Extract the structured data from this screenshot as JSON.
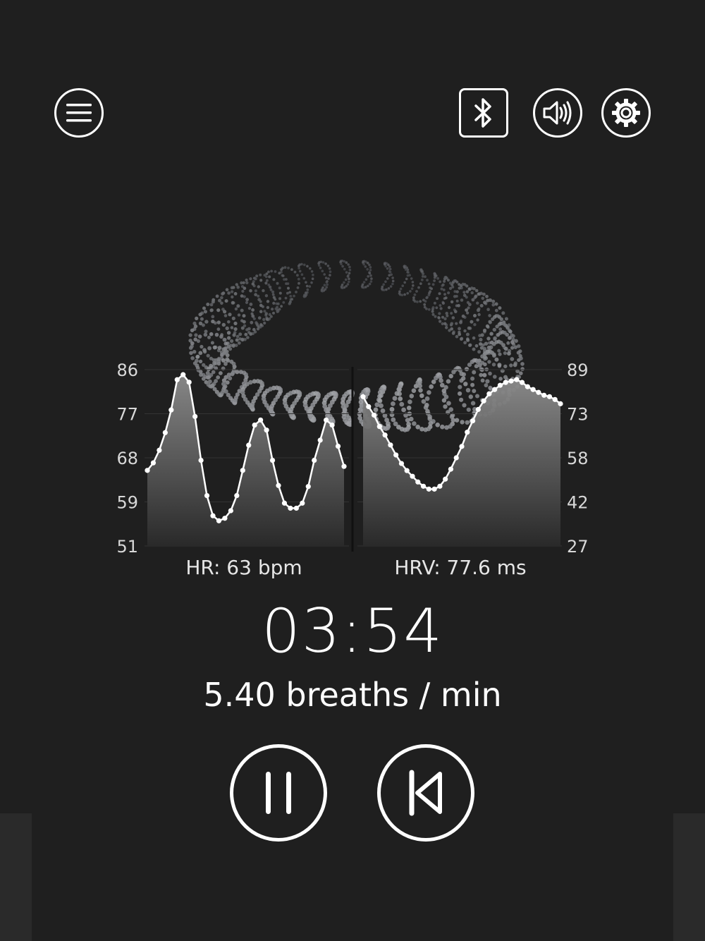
{
  "icons": {
    "menu": "hamburger-menu-icon",
    "bluetooth": "bluetooth-icon",
    "sound": "speaker-volume-icon",
    "settings": "gear-icon",
    "pause": "pause-icon",
    "restart": "skip-back-icon"
  },
  "colors": {
    "background": "#1f1f1f",
    "foreground": "#ffffff",
    "visualization": "#8a8d93"
  },
  "chart_data": [
    {
      "type": "line",
      "title": "",
      "caption": "HR: 63 bpm",
      "y_ticks": [
        "86",
        "77",
        "68",
        "59",
        "51"
      ],
      "ylim": [
        51,
        86
      ],
      "fill": "area-gradient",
      "series": [
        {
          "values": [
            66,
            67.5,
            70,
            73.5,
            78,
            84,
            85,
            83.5,
            76.7,
            68,
            61,
            57,
            56,
            56.5,
            58,
            61,
            66,
            71,
            75,
            76,
            74,
            68,
            63,
            59.5,
            58.5,
            58.5,
            59.5,
            62.8,
            68,
            72,
            76,
            75,
            70.8,
            66.8
          ]
        }
      ]
    },
    {
      "type": "line",
      "title": "",
      "caption": "HRV: 77.6 ms",
      "y_ticks": [
        "89",
        "73",
        "58",
        "42",
        "27"
      ],
      "ylim": [
        27,
        89
      ],
      "fill": "area-gradient",
      "series": [
        {
          "values": [
            79.5,
            76,
            73,
            69,
            66,
            62.5,
            59,
            56,
            53.5,
            51.5,
            49.5,
            48,
            47,
            47,
            48,
            50.5,
            54,
            58,
            62,
            67,
            71,
            75,
            78,
            80.5,
            82,
            83.5,
            84.5,
            85,
            85.5,
            84.5,
            83,
            82,
            81,
            80,
            79.5,
            78.5,
            77
          ]
        }
      ]
    }
  ],
  "labels": {
    "hr_caption": "HR: 63 bpm",
    "hrv_caption": "HRV: 77.6 ms"
  },
  "session": {
    "timer": "03:54",
    "rate": "5.40 breaths / min"
  }
}
